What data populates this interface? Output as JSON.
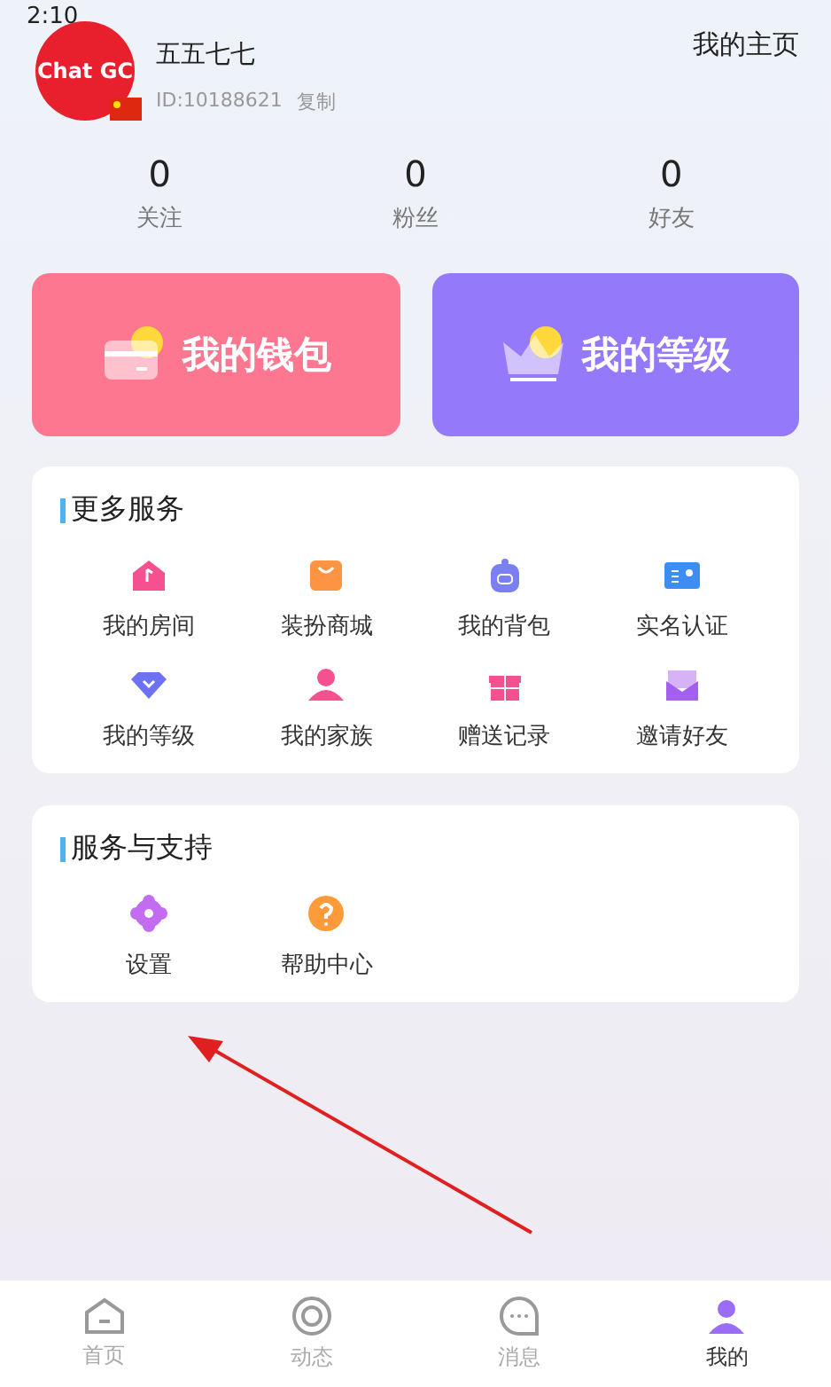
{
  "status_bar": {
    "time": "2:10"
  },
  "profile": {
    "avatar_text": "Chat GC",
    "name": "五五七七",
    "id": "ID:10188621",
    "copy": "复制",
    "home_link": "我的主页"
  },
  "stats": [
    {
      "value": "0",
      "label": "关注"
    },
    {
      "value": "0",
      "label": "粉丝"
    },
    {
      "value": "0",
      "label": "好友"
    }
  ],
  "big_cards": [
    {
      "kind": "wallet",
      "label": "我的钱包"
    },
    {
      "kind": "level",
      "label": "我的等级"
    }
  ],
  "sections": [
    {
      "title": "更多服务",
      "items": [
        {
          "kind": "room",
          "label": "我的房间"
        },
        {
          "kind": "shop",
          "label": "装扮商城"
        },
        {
          "kind": "bag",
          "label": "我的背包"
        },
        {
          "kind": "idcard",
          "label": "实名认证"
        },
        {
          "kind": "diamond",
          "label": "我的等级"
        },
        {
          "kind": "person",
          "label": "我的家族"
        },
        {
          "kind": "gift",
          "label": "赠送记录"
        },
        {
          "kind": "mail",
          "label": "邀请好友"
        }
      ]
    },
    {
      "title": "服务与支持",
      "items": [
        {
          "kind": "gear",
          "label": "设置"
        },
        {
          "kind": "help",
          "label": "帮助中心"
        }
      ]
    }
  ],
  "bottom_nav": [
    {
      "kind": "home",
      "label": "首页",
      "selected": false
    },
    {
      "kind": "ring",
      "label": "动态",
      "selected": false
    },
    {
      "kind": "chat",
      "label": "消息",
      "selected": false
    },
    {
      "kind": "me",
      "label": "我的",
      "selected": true
    }
  ]
}
